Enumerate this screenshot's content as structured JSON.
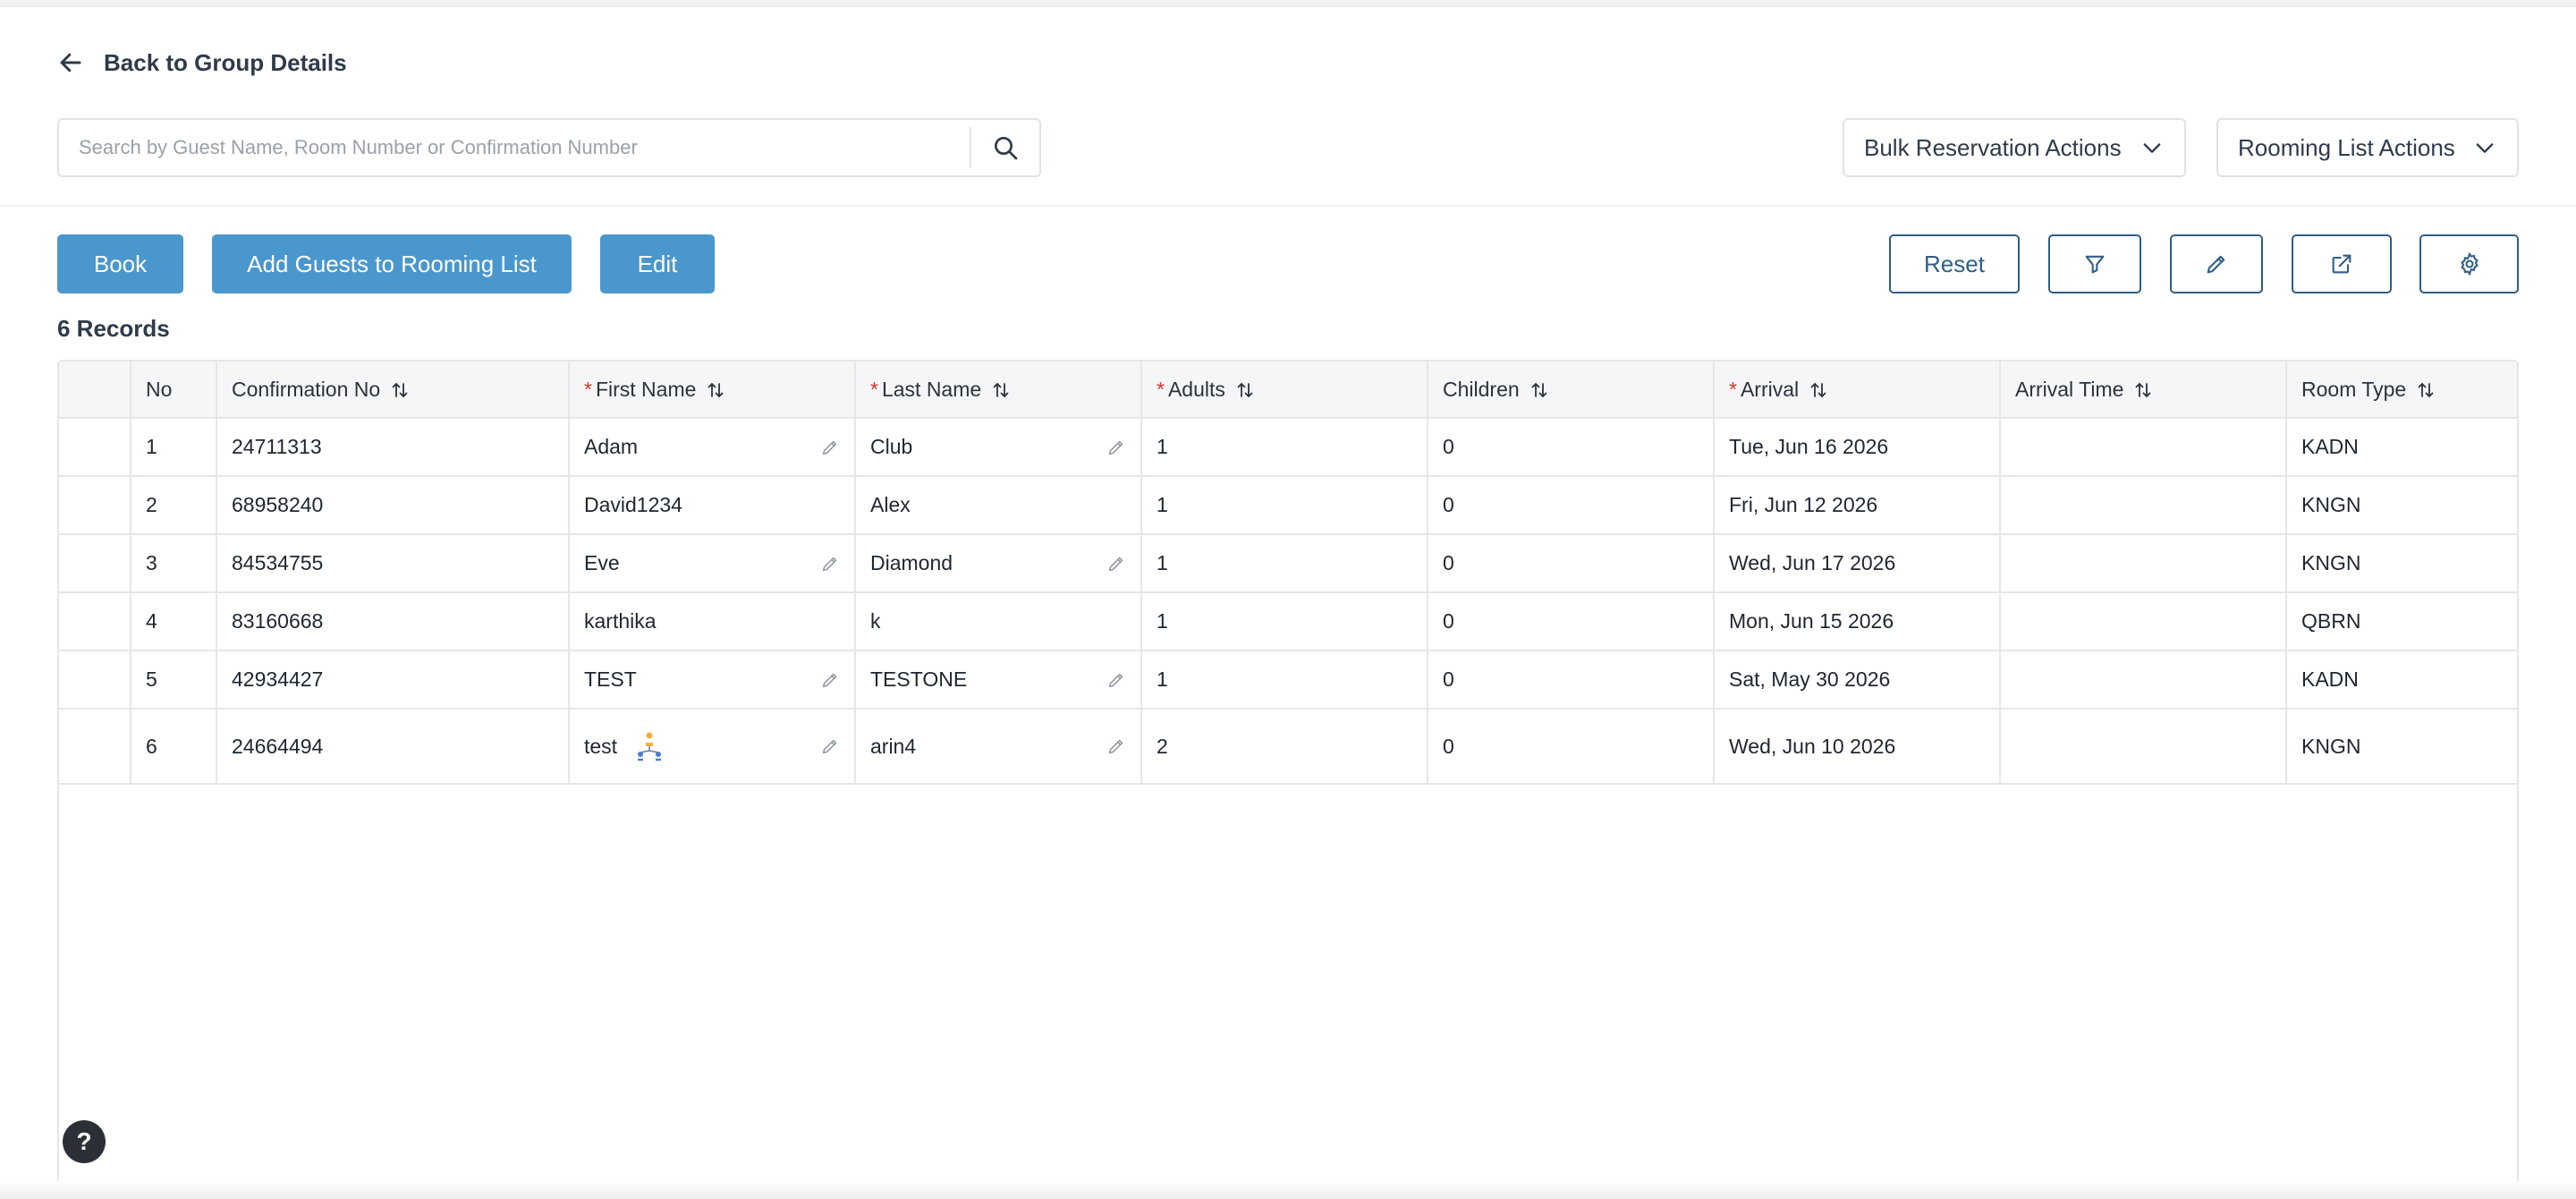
{
  "nav": {
    "back_label": "Back to Group Details"
  },
  "search": {
    "placeholder": "Search by Guest Name, Room Number or Confirmation Number",
    "value": ""
  },
  "dropdowns": {
    "bulk_label": "Bulk Reservation Actions",
    "rooming_label": "Rooming List Actions"
  },
  "toolbar": {
    "book_label": "Book",
    "add_guests_label": "Add Guests to Rooming List",
    "edit_label": "Edit",
    "reset_label": "Reset",
    "icons": [
      "filter-icon",
      "pencil-icon",
      "external-link-icon",
      "gear-icon"
    ]
  },
  "records_label": "6 Records",
  "table": {
    "columns": [
      {
        "label": "",
        "required": false,
        "sortable": false
      },
      {
        "label": "No",
        "required": false,
        "sortable": false
      },
      {
        "label": "Confirmation No",
        "required": false,
        "sortable": true
      },
      {
        "label": "First Name",
        "required": true,
        "sortable": true
      },
      {
        "label": "Last Name",
        "required": true,
        "sortable": true
      },
      {
        "label": "Adults",
        "required": true,
        "sortable": true
      },
      {
        "label": "Children",
        "required": false,
        "sortable": true
      },
      {
        "label": "Arrival",
        "required": true,
        "sortable": true
      },
      {
        "label": "Arrival Time",
        "required": false,
        "sortable": true
      },
      {
        "label": "Room Type",
        "required": false,
        "sortable": true
      }
    ],
    "rows": [
      {
        "no": "1",
        "confirmation": "24711313",
        "first_name": "Adam",
        "first_editable": true,
        "last_name": "Club",
        "last_editable": true,
        "adults": "1",
        "children": "0",
        "arrival": "Tue, Jun 16 2026",
        "arrival_time": "",
        "room_type": "KADN",
        "shared": false
      },
      {
        "no": "2",
        "confirmation": "68958240",
        "first_name": "David1234",
        "first_editable": false,
        "last_name": "Alex",
        "last_editable": false,
        "adults": "1",
        "children": "0",
        "arrival": "Fri, Jun 12 2026",
        "arrival_time": "",
        "room_type": "KNGN",
        "shared": false
      },
      {
        "no": "3",
        "confirmation": "84534755",
        "first_name": "Eve",
        "first_editable": true,
        "last_name": "Diamond",
        "last_editable": true,
        "adults": "1",
        "children": "0",
        "arrival": "Wed, Jun 17 2026",
        "arrival_time": "",
        "room_type": "KNGN",
        "shared": false
      },
      {
        "no": "4",
        "confirmation": "83160668",
        "first_name": "karthika",
        "first_editable": false,
        "last_name": "k",
        "last_editable": false,
        "adults": "1",
        "children": "0",
        "arrival": "Mon, Jun 15 2026",
        "arrival_time": "",
        "room_type": "QBRN",
        "shared": false
      },
      {
        "no": "5",
        "confirmation": "42934427",
        "first_name": "TEST",
        "first_editable": true,
        "last_name": "TESTONE",
        "last_editable": true,
        "adults": "1",
        "children": "0",
        "arrival": "Sat, May 30 2026",
        "arrival_time": "",
        "room_type": "KADN",
        "shared": false
      },
      {
        "no": "6",
        "confirmation": "24664494",
        "first_name": "test",
        "first_editable": true,
        "last_name": "arin4",
        "last_editable": true,
        "adults": "2",
        "children": "0",
        "arrival": "Wed, Jun 10 2026",
        "arrival_time": "",
        "room_type": "KNGN",
        "shared": true
      }
    ]
  },
  "help": {
    "label": "?"
  },
  "colors": {
    "primary": "#4a97cd",
    "outline": "#2f5f86",
    "required": "#d9342b"
  }
}
